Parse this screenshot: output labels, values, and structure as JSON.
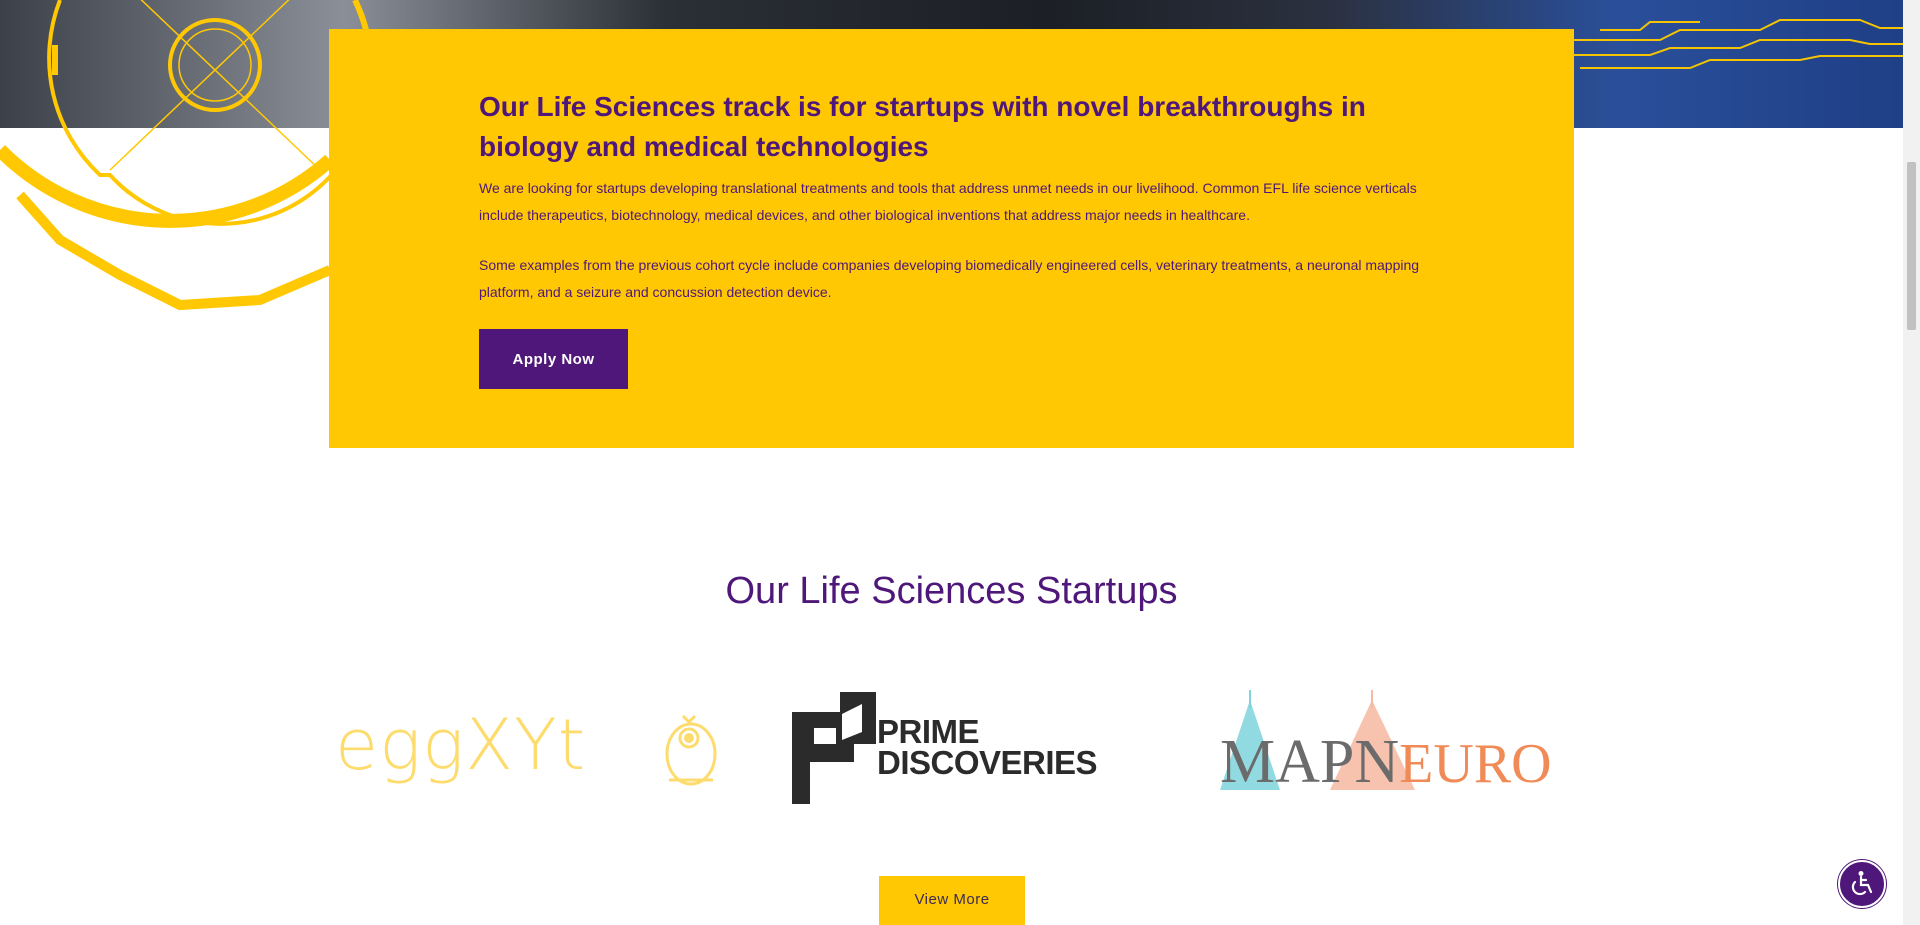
{
  "card": {
    "title": "Our Life Sciences track is for startups with novel breakthroughs in biology and medical technologies",
    "paragraph1": "We are looking for startups developing translational treatments and tools that address unmet needs in our livelihood. Common EFL life science verticals include therapeutics, biotechnology, medical devices, and other biological inventions that address major needs in healthcare.",
    "paragraph2": "Some examples from the previous cohort cycle include companies developing biomedically engineered cells, veterinary treatments, a neuronal mapping platform, and a seizure and concussion detection device.",
    "apply_label": "Apply Now"
  },
  "startups": {
    "heading": "Our Life Sciences Startups",
    "logos": [
      {
        "name": "eggXYt",
        "text": "eggXYt"
      },
      {
        "name": "Prime Discoveries",
        "line1": "PRIME",
        "line2": "DISCOVERIES"
      },
      {
        "name": "MapNeuro",
        "map": "MAP",
        "neuro_n": "N",
        "neuro_rest": "EURO"
      }
    ],
    "view_more_label": "View More"
  },
  "colors": {
    "brand_purple": "#4e1779",
    "brand_yellow": "#ffc803",
    "eggxyt_yellow": "#fddb6c",
    "mapneuro_orange": "#f08a56",
    "mapneuro_teal": "#7fd3dc"
  },
  "icons": {
    "accessibility": "wheelchair-accessibility-icon"
  }
}
